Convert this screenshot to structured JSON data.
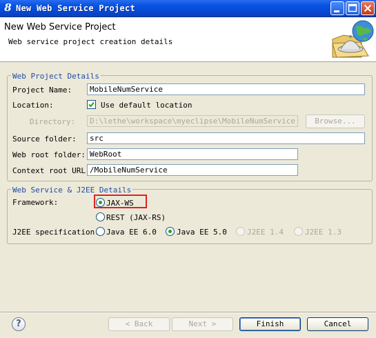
{
  "window": {
    "title": "New Web Service Project"
  },
  "banner": {
    "title": "New Web Service Project",
    "description": "Web service project creation details"
  },
  "web_project": {
    "legend": "Web Project Details",
    "project_name_label": "Project Name:",
    "project_name_value": "MobileNumService",
    "location_label": "Location:",
    "use_default_label": "Use default location",
    "use_default_checked": true,
    "directory_label": "Directory:",
    "directory_value": "D:\\lethe\\workspace\\myeclipse\\MobileNumService",
    "browse_label": "Browse...",
    "source_folder_label": "Source folder:",
    "source_folder_value": "src",
    "web_root_label": "Web root folder:",
    "web_root_value": "WebRoot",
    "context_root_label": "Context root URL:",
    "context_root_value": "/MobileNumService"
  },
  "ws_details": {
    "legend": "Web Service & J2EE Details",
    "framework_label": "Framework:",
    "framework_options": [
      "JAX-WS",
      "REST (JAX-RS)"
    ],
    "framework_selected": "JAX-WS",
    "j2ee_label": "J2EE specification:",
    "j2ee_options": [
      "Java EE 6.0",
      "Java EE 5.0",
      "J2EE 1.4",
      "J2EE 1.3"
    ],
    "j2ee_selected": "Java EE 5.0"
  },
  "buttons": {
    "back": "< Back",
    "next": "Next >",
    "finish": "Finish",
    "cancel": "Cancel",
    "help": "?"
  },
  "colors": {
    "title_bar": "#0a55e3",
    "group_label": "#1f4ca8",
    "highlight": "#e02020"
  }
}
